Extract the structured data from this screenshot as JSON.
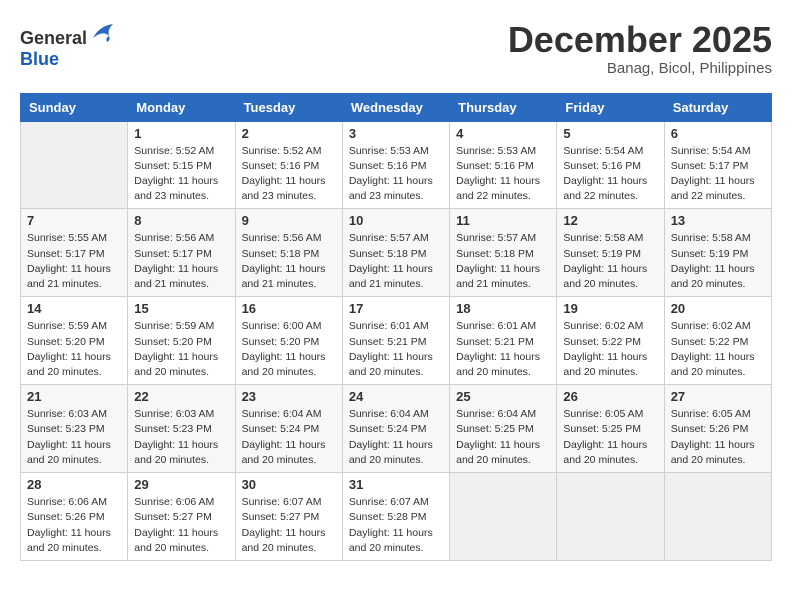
{
  "header": {
    "logo_general": "General",
    "logo_blue": "Blue",
    "month": "December 2025",
    "location": "Banag, Bicol, Philippines"
  },
  "days_of_week": [
    "Sunday",
    "Monday",
    "Tuesday",
    "Wednesday",
    "Thursday",
    "Friday",
    "Saturday"
  ],
  "weeks": [
    [
      {
        "day": "",
        "info": ""
      },
      {
        "day": "1",
        "info": "Sunrise: 5:52 AM\nSunset: 5:15 PM\nDaylight: 11 hours\nand 23 minutes."
      },
      {
        "day": "2",
        "info": "Sunrise: 5:52 AM\nSunset: 5:16 PM\nDaylight: 11 hours\nand 23 minutes."
      },
      {
        "day": "3",
        "info": "Sunrise: 5:53 AM\nSunset: 5:16 PM\nDaylight: 11 hours\nand 23 minutes."
      },
      {
        "day": "4",
        "info": "Sunrise: 5:53 AM\nSunset: 5:16 PM\nDaylight: 11 hours\nand 22 minutes."
      },
      {
        "day": "5",
        "info": "Sunrise: 5:54 AM\nSunset: 5:16 PM\nDaylight: 11 hours\nand 22 minutes."
      },
      {
        "day": "6",
        "info": "Sunrise: 5:54 AM\nSunset: 5:17 PM\nDaylight: 11 hours\nand 22 minutes."
      }
    ],
    [
      {
        "day": "7",
        "info": "Sunrise: 5:55 AM\nSunset: 5:17 PM\nDaylight: 11 hours\nand 21 minutes."
      },
      {
        "day": "8",
        "info": "Sunrise: 5:56 AM\nSunset: 5:17 PM\nDaylight: 11 hours\nand 21 minutes."
      },
      {
        "day": "9",
        "info": "Sunrise: 5:56 AM\nSunset: 5:18 PM\nDaylight: 11 hours\nand 21 minutes."
      },
      {
        "day": "10",
        "info": "Sunrise: 5:57 AM\nSunset: 5:18 PM\nDaylight: 11 hours\nand 21 minutes."
      },
      {
        "day": "11",
        "info": "Sunrise: 5:57 AM\nSunset: 5:18 PM\nDaylight: 11 hours\nand 21 minutes."
      },
      {
        "day": "12",
        "info": "Sunrise: 5:58 AM\nSunset: 5:19 PM\nDaylight: 11 hours\nand 20 minutes."
      },
      {
        "day": "13",
        "info": "Sunrise: 5:58 AM\nSunset: 5:19 PM\nDaylight: 11 hours\nand 20 minutes."
      }
    ],
    [
      {
        "day": "14",
        "info": "Sunrise: 5:59 AM\nSunset: 5:20 PM\nDaylight: 11 hours\nand 20 minutes."
      },
      {
        "day": "15",
        "info": "Sunrise: 5:59 AM\nSunset: 5:20 PM\nDaylight: 11 hours\nand 20 minutes."
      },
      {
        "day": "16",
        "info": "Sunrise: 6:00 AM\nSunset: 5:20 PM\nDaylight: 11 hours\nand 20 minutes."
      },
      {
        "day": "17",
        "info": "Sunrise: 6:01 AM\nSunset: 5:21 PM\nDaylight: 11 hours\nand 20 minutes."
      },
      {
        "day": "18",
        "info": "Sunrise: 6:01 AM\nSunset: 5:21 PM\nDaylight: 11 hours\nand 20 minutes."
      },
      {
        "day": "19",
        "info": "Sunrise: 6:02 AM\nSunset: 5:22 PM\nDaylight: 11 hours\nand 20 minutes."
      },
      {
        "day": "20",
        "info": "Sunrise: 6:02 AM\nSunset: 5:22 PM\nDaylight: 11 hours\nand 20 minutes."
      }
    ],
    [
      {
        "day": "21",
        "info": "Sunrise: 6:03 AM\nSunset: 5:23 PM\nDaylight: 11 hours\nand 20 minutes."
      },
      {
        "day": "22",
        "info": "Sunrise: 6:03 AM\nSunset: 5:23 PM\nDaylight: 11 hours\nand 20 minutes."
      },
      {
        "day": "23",
        "info": "Sunrise: 6:04 AM\nSunset: 5:24 PM\nDaylight: 11 hours\nand 20 minutes."
      },
      {
        "day": "24",
        "info": "Sunrise: 6:04 AM\nSunset: 5:24 PM\nDaylight: 11 hours\nand 20 minutes."
      },
      {
        "day": "25",
        "info": "Sunrise: 6:04 AM\nSunset: 5:25 PM\nDaylight: 11 hours\nand 20 minutes."
      },
      {
        "day": "26",
        "info": "Sunrise: 6:05 AM\nSunset: 5:25 PM\nDaylight: 11 hours\nand 20 minutes."
      },
      {
        "day": "27",
        "info": "Sunrise: 6:05 AM\nSunset: 5:26 PM\nDaylight: 11 hours\nand 20 minutes."
      }
    ],
    [
      {
        "day": "28",
        "info": "Sunrise: 6:06 AM\nSunset: 5:26 PM\nDaylight: 11 hours\nand 20 minutes."
      },
      {
        "day": "29",
        "info": "Sunrise: 6:06 AM\nSunset: 5:27 PM\nDaylight: 11 hours\nand 20 minutes."
      },
      {
        "day": "30",
        "info": "Sunrise: 6:07 AM\nSunset: 5:27 PM\nDaylight: 11 hours\nand 20 minutes."
      },
      {
        "day": "31",
        "info": "Sunrise: 6:07 AM\nSunset: 5:28 PM\nDaylight: 11 hours\nand 20 minutes."
      },
      {
        "day": "",
        "info": ""
      },
      {
        "day": "",
        "info": ""
      },
      {
        "day": "",
        "info": ""
      }
    ]
  ]
}
